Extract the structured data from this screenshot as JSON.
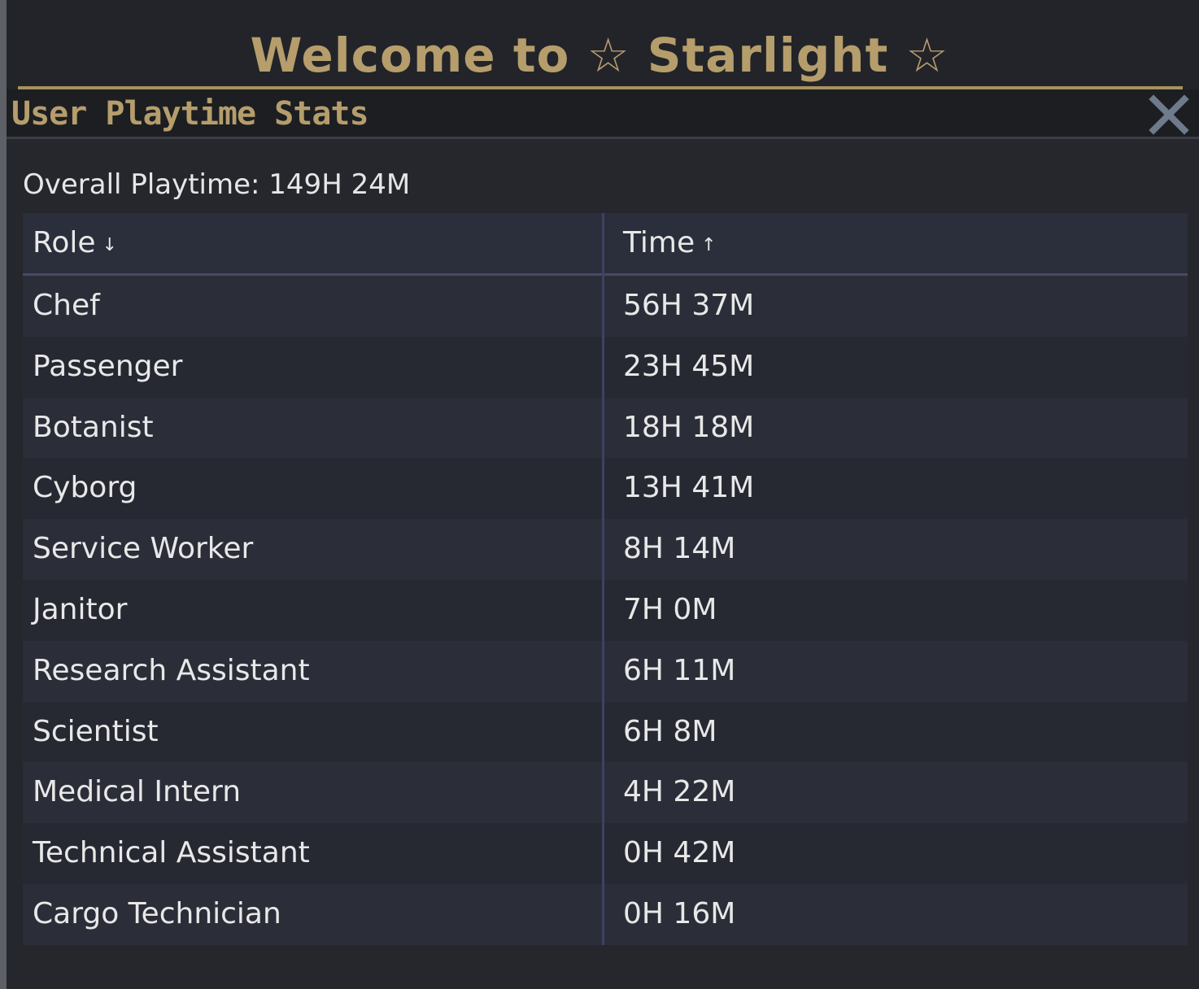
{
  "banner": {
    "title": "Welcome to ☆ Starlight ☆"
  },
  "window": {
    "title": "User Playtime Stats",
    "close_icon": "close-icon"
  },
  "summary": {
    "overall": "Overall Playtime: 149H 24M"
  },
  "table": {
    "columns": [
      {
        "label": "Role",
        "sort_glyph": "↓"
      },
      {
        "label": "Time",
        "sort_glyph": "↑"
      }
    ],
    "rows": [
      {
        "role": "Chef",
        "time": "56H 37M"
      },
      {
        "role": "Passenger",
        "time": "23H 45M"
      },
      {
        "role": "Botanist",
        "time": "18H 18M"
      },
      {
        "role": "Cyborg",
        "time": "13H 41M"
      },
      {
        "role": "Service Worker",
        "time": "8H 14M"
      },
      {
        "role": "Janitor",
        "time": "7H 0M"
      },
      {
        "role": "Research Assistant",
        "time": "6H 11M"
      },
      {
        "role": "Scientist",
        "time": "6H 8M"
      },
      {
        "role": "Medical Intern",
        "time": "4H 22M"
      },
      {
        "role": "Technical Assistant",
        "time": "0H 42M"
      },
      {
        "role": "Cargo Technician",
        "time": "0H 16M"
      }
    ]
  },
  "colors": {
    "accent_gold": "#b59d6c",
    "text": "#e8e8e8",
    "panel": "#25272d"
  }
}
